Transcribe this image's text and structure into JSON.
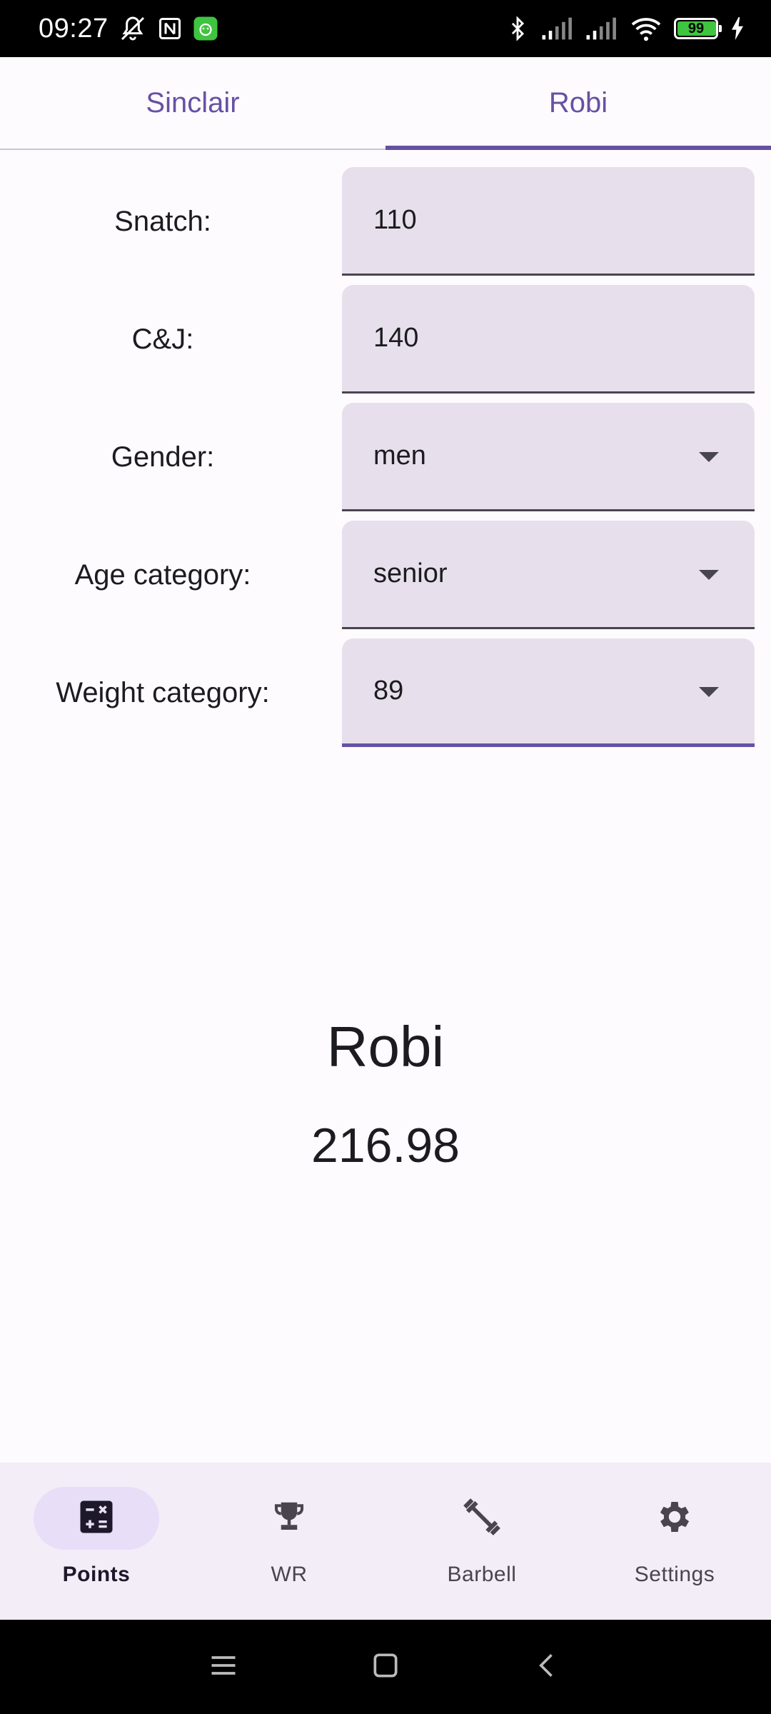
{
  "status_bar": {
    "time": "09:27",
    "battery_level": "99",
    "icons": [
      "mute-icon",
      "nfc-icon",
      "app-notification-icon",
      "bluetooth-icon",
      "signal-icon",
      "signal-icon",
      "wifi-icon",
      "battery-icon",
      "charging-icon"
    ]
  },
  "tabs": [
    {
      "label": "Sinclair",
      "active": false
    },
    {
      "label": "Robi",
      "active": true
    }
  ],
  "form": {
    "snatch": {
      "label": "Snatch:",
      "value": "110"
    },
    "cj": {
      "label": "C&J:",
      "value": "140"
    },
    "gender": {
      "label": "Gender:",
      "value": "men"
    },
    "age_category": {
      "label": "Age category:",
      "value": "senior"
    },
    "weight_category": {
      "label": "Weight category:",
      "value": "89"
    }
  },
  "result": {
    "title": "Robi",
    "value": "216.98"
  },
  "bottom_nav": [
    {
      "label": "Points",
      "icon": "calculator-icon",
      "active": true
    },
    {
      "label": "WR",
      "icon": "trophy-icon",
      "active": false
    },
    {
      "label": "Barbell",
      "icon": "barbell-icon",
      "active": false
    },
    {
      "label": "Settings",
      "icon": "gear-icon",
      "active": false
    }
  ],
  "colors": {
    "primary": "#6750a4",
    "field_bg": "#e7e0ec",
    "nav_bg": "#f3edf7",
    "nav_active_pill": "#e8def8",
    "background": "#fefbff"
  }
}
